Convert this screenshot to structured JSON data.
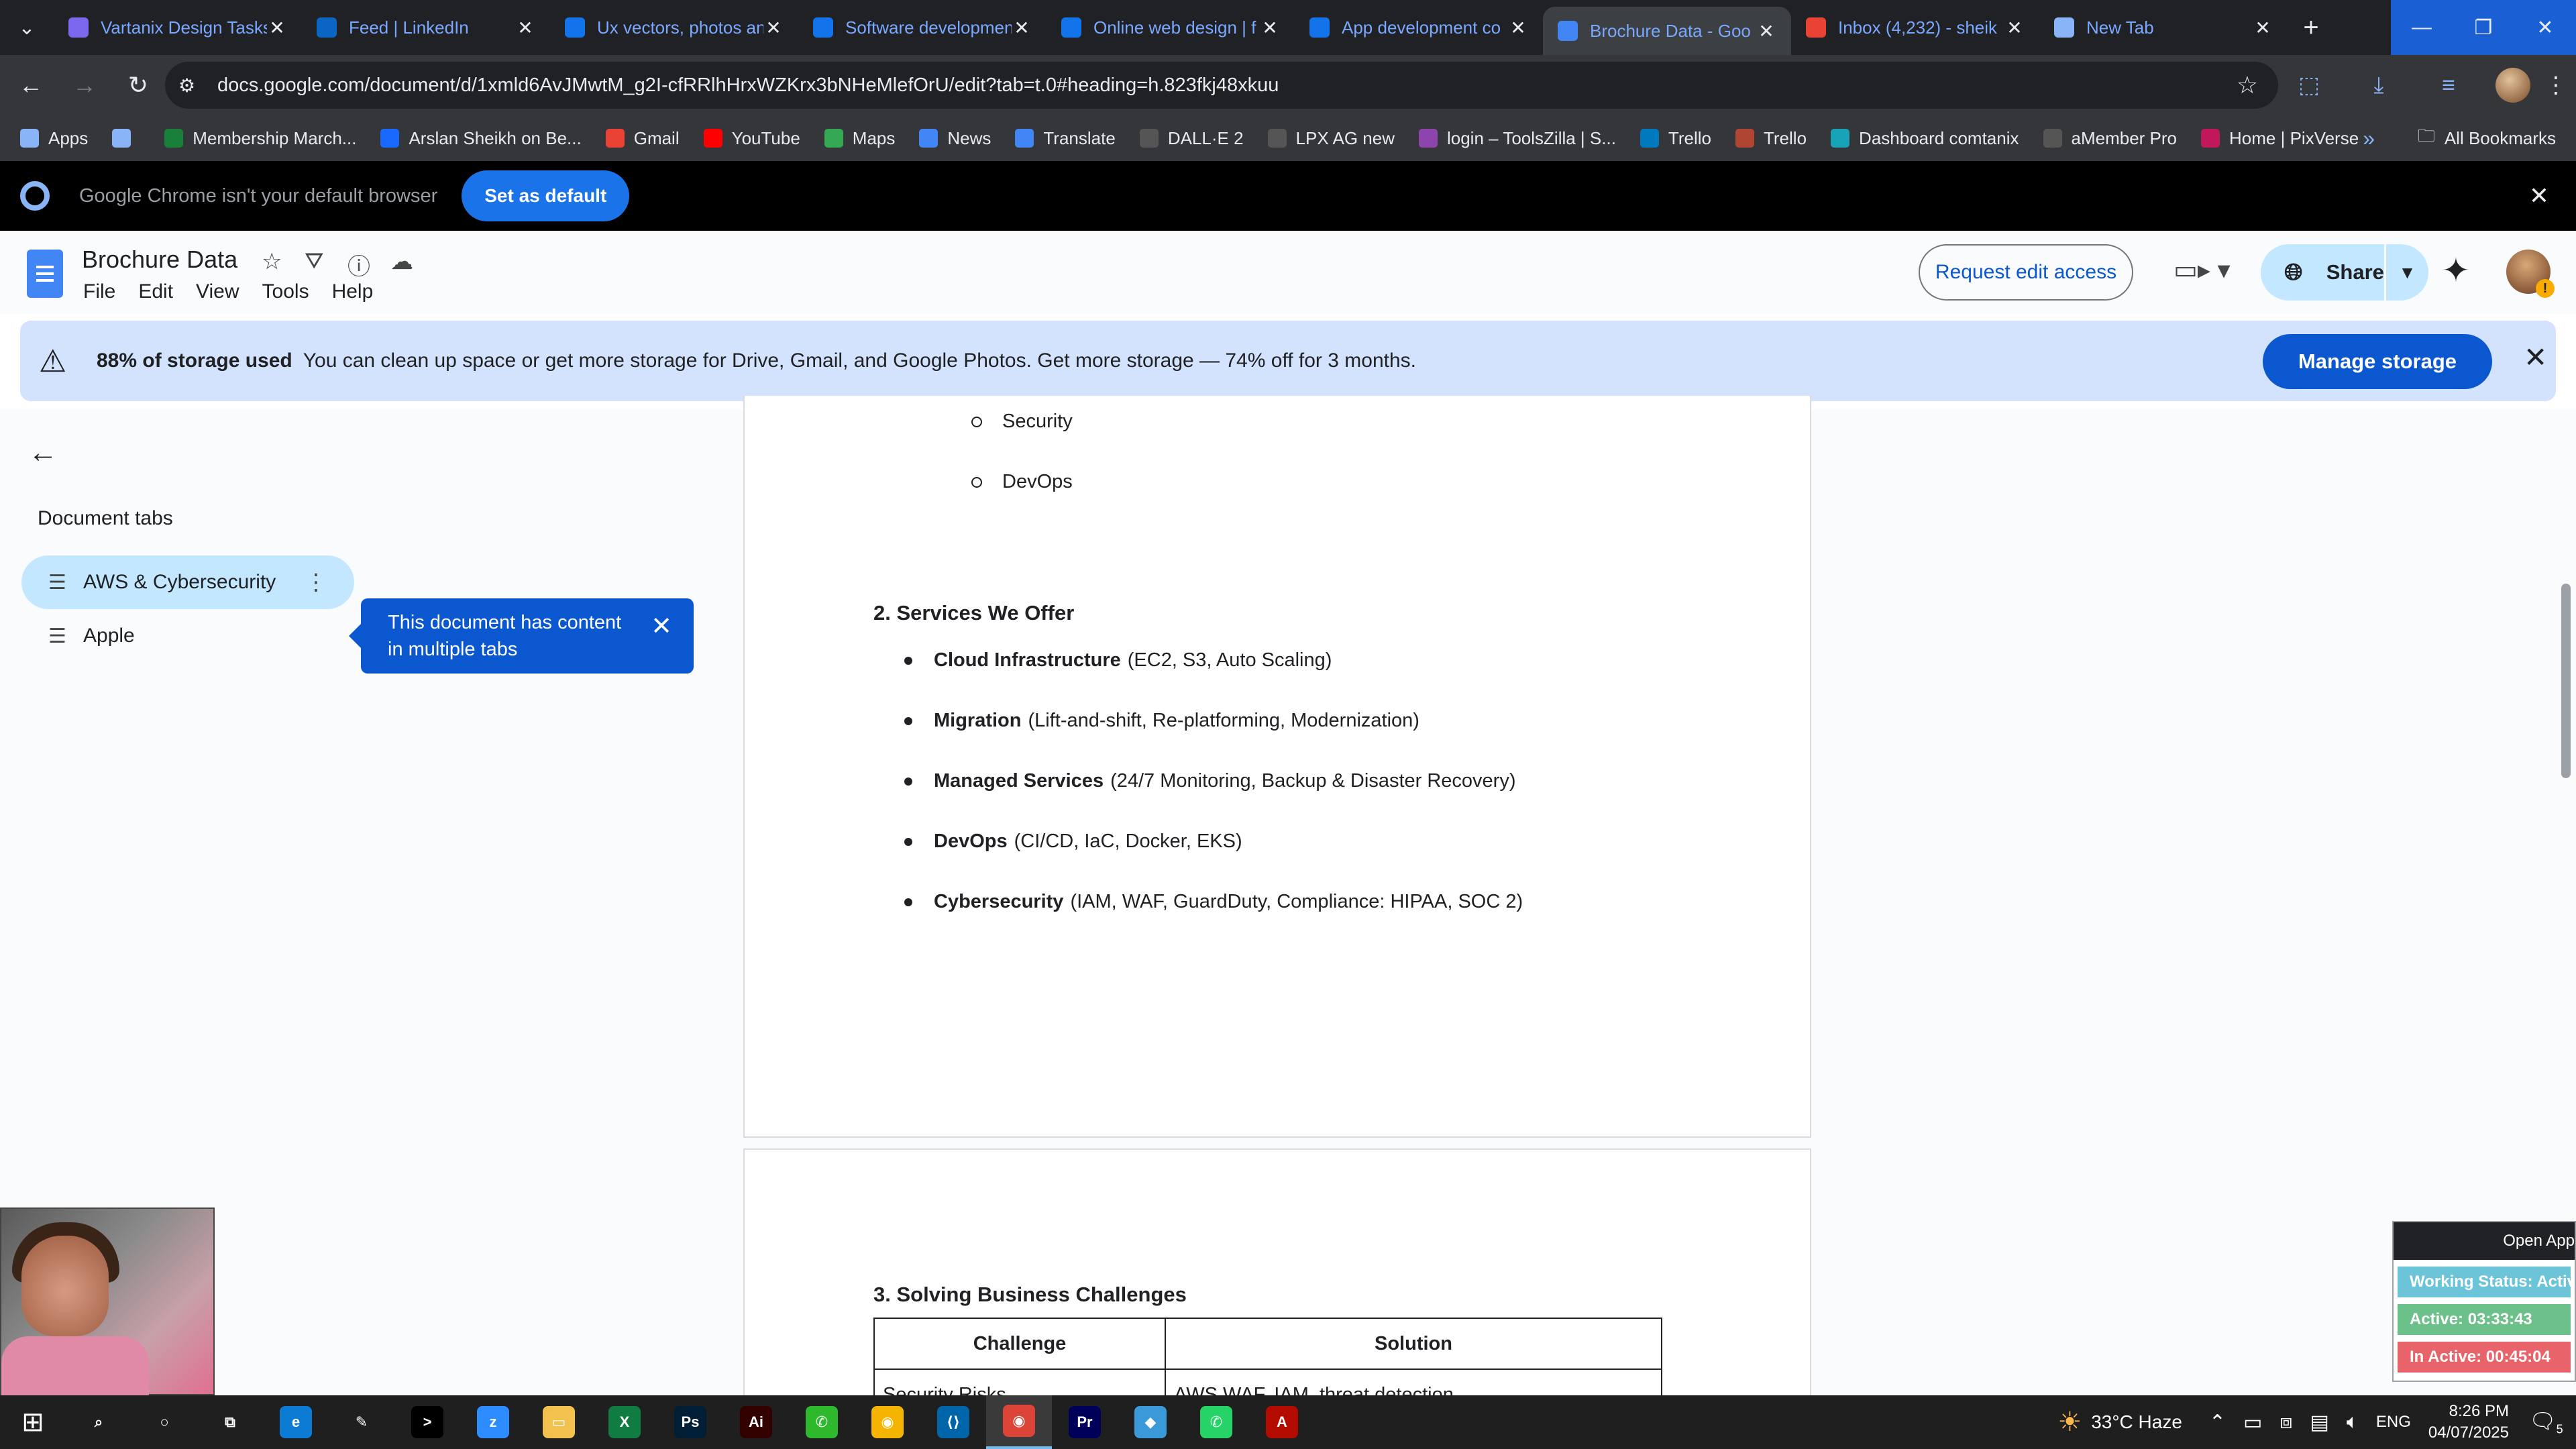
{
  "tabs": [
    {
      "title": "Vartanix Design Tasks",
      "icon": "clickup-icon",
      "color": "#7b68ee"
    },
    {
      "title": "Feed | LinkedIn",
      "icon": "linkedin-icon",
      "color": "#0a66c2"
    },
    {
      "title": "Ux vectors, photos an",
      "icon": "freepik-icon",
      "color": "#1273eb"
    },
    {
      "title": "Software developmen",
      "icon": "freepik-icon",
      "color": "#1273eb"
    },
    {
      "title": "Online web design | f",
      "icon": "freepik-icon",
      "color": "#1273eb"
    },
    {
      "title": "App development co",
      "icon": "freepik-icon",
      "color": "#1273eb"
    },
    {
      "title": "Brochure Data - Goo",
      "icon": "docs-icon",
      "color": "#4285f4"
    },
    {
      "title": "Inbox (4,232) - sheik",
      "icon": "gmail-icon",
      "color": "#ea4335"
    },
    {
      "title": "New Tab",
      "icon": "chrome-icon",
      "color": "#8ab4f8"
    }
  ],
  "address": {
    "url": "docs.google.com/document/d/1xmld6AvJMwtM_g2I-cfRRlhHrxWZKrx3bNHeMlefOrU/edit?tab=t.0#heading=h.823fkj48xkuu"
  },
  "bookmarks": [
    {
      "label": "Apps",
      "icon": "apps-grid-icon",
      "color": "#8ab4f8"
    },
    {
      "label": "",
      "icon": "grid-icon",
      "color": "#8ab4f8"
    },
    {
      "label": "Membership March...",
      "icon": "plus-icon",
      "color": "#188038"
    },
    {
      "label": "Arslan Sheikh on Be...",
      "icon": "behance-icon",
      "color": "#1769ff"
    },
    {
      "label": "Gmail",
      "icon": "gmail-icon",
      "color": "#ea4335"
    },
    {
      "label": "YouTube",
      "icon": "youtube-icon",
      "color": "#ff0000"
    },
    {
      "label": "Maps",
      "icon": "maps-icon",
      "color": "#34a853"
    },
    {
      "label": "News",
      "icon": "news-icon",
      "color": "#4285f4"
    },
    {
      "label": "Translate",
      "icon": "translate-icon",
      "color": "#4285f4"
    },
    {
      "label": "DALL·E 2",
      "icon": "openai-icon",
      "color": "#555555"
    },
    {
      "label": "LPX AG new",
      "icon": "dots-icon",
      "color": "#555555"
    },
    {
      "label": "login – ToolsZilla | S...",
      "icon": "toolszilla-icon",
      "color": "#8e44ad"
    },
    {
      "label": "Trello",
      "icon": "trello-icon",
      "color": "#0079bf"
    },
    {
      "label": "Trello",
      "icon": "trello-icon",
      "color": "#b04632"
    },
    {
      "label": "Dashboard comtanix",
      "icon": "comtanix-icon",
      "color": "#17a2b8"
    },
    {
      "label": "aMember Pro",
      "icon": "amember-icon",
      "color": "#555555"
    },
    {
      "label": "Home | PixVerse",
      "icon": "pixverse-icon",
      "color": "#c2185b"
    }
  ],
  "bookmarks_all": "All Bookmarks",
  "infobar": {
    "message": "Google Chrome isn't your default browser",
    "button": "Set as default"
  },
  "doc": {
    "title": "Brochure Data",
    "menu": [
      "File",
      "Edit",
      "View",
      "Tools",
      "Help"
    ],
    "request_edit": "Request edit access",
    "share": "Share"
  },
  "storage": {
    "bold": "88% of storage used",
    "text": "You can clean up space or get more storage for Drive, Gmail, and Google Photos. Get more storage — 74% off for 3 months.",
    "button": "Manage storage"
  },
  "sidebar": {
    "heading": "Document tabs",
    "tabs": [
      {
        "label": "AWS & Cybersecurity",
        "active": true
      },
      {
        "label": "Apple",
        "active": false
      }
    ],
    "tooltip": "This document has content in multiple tabs"
  },
  "content": {
    "sub_bullets": [
      "Security",
      "DevOps"
    ],
    "section2": "2. Services We Offer",
    "services": [
      {
        "name": "Cloud Infrastructure",
        "detail": "(EC2, S3, Auto Scaling)"
      },
      {
        "name": "Migration",
        "detail": "(Lift-and-shift, Re-platforming, Modernization)"
      },
      {
        "name": "Managed Services",
        "detail": "(24/7 Monitoring, Backup & Disaster Recovery)"
      },
      {
        "name": "DevOps",
        "detail": "(CI/CD, IaC, Docker, EKS)"
      },
      {
        "name": "Cybersecurity",
        "detail": "(IAM, WAF, GuardDuty, Compliance: HIPAA, SOC 2)"
      }
    ],
    "section3": "3. Solving Business Challenges",
    "table": {
      "headers": [
        "Challenge",
        "Solution"
      ],
      "rows": [
        [
          "Security Risks",
          "AWS WAF, IAM, threat detection"
        ]
      ]
    }
  },
  "tracker": {
    "open": "Open App",
    "working": "Working Status: Active",
    "active": "Active: 03:33:43",
    "inactive": "In Active: 00:45:04"
  },
  "taskbar": {
    "apps": [
      {
        "icon": "search-icon",
        "color": "#1f1f1f",
        "glyph": "⌕"
      },
      {
        "icon": "cortana-icon",
        "color": "#1f1f1f",
        "glyph": "○"
      },
      {
        "icon": "task-view-icon",
        "color": "#1f1f1f",
        "glyph": "⧉"
      },
      {
        "icon": "edge-icon",
        "color": "#0c7bd4",
        "glyph": "e"
      },
      {
        "icon": "pen-tool-icon",
        "color": "#1f1f1f",
        "glyph": "✎"
      },
      {
        "icon": "terminal-icon",
        "color": "#000000",
        "glyph": ">"
      },
      {
        "icon": "zoom-icon",
        "color": "#2d8cff",
        "glyph": "z"
      },
      {
        "icon": "file-explorer-icon",
        "color": "#f2c14e",
        "glyph": "▭"
      },
      {
        "icon": "excel-icon",
        "color": "#107c41",
        "glyph": "X"
      },
      {
        "icon": "photoshop-icon",
        "color": "#001e36",
        "glyph": "Ps"
      },
      {
        "icon": "illustrator-icon",
        "color": "#330000",
        "glyph": "Ai"
      },
      {
        "icon": "phone-link-icon",
        "color": "#2eb82e",
        "glyph": "✆"
      },
      {
        "icon": "chrome-icon",
        "color": "#f4b400",
        "glyph": "◉"
      },
      {
        "icon": "vscode-icon",
        "color": "#0065a9",
        "glyph": "⟨⟩"
      },
      {
        "icon": "chrome-active-icon",
        "color": "#db4437",
        "glyph": "◉"
      },
      {
        "icon": "premiere-icon",
        "color": "#00005b",
        "glyph": "Pr"
      },
      {
        "icon": "comtanix-app-icon",
        "color": "#3a9ad9",
        "glyph": "◆"
      },
      {
        "icon": "whatsapp-icon",
        "color": "#25d366",
        "glyph": "✆"
      },
      {
        "icon": "acrobat-icon",
        "color": "#b30b00",
        "glyph": "A"
      }
    ],
    "weather": "33°C Haze",
    "lang": "ENG",
    "time": "8:26 PM",
    "date": "04/07/2025",
    "notifications": "5"
  }
}
